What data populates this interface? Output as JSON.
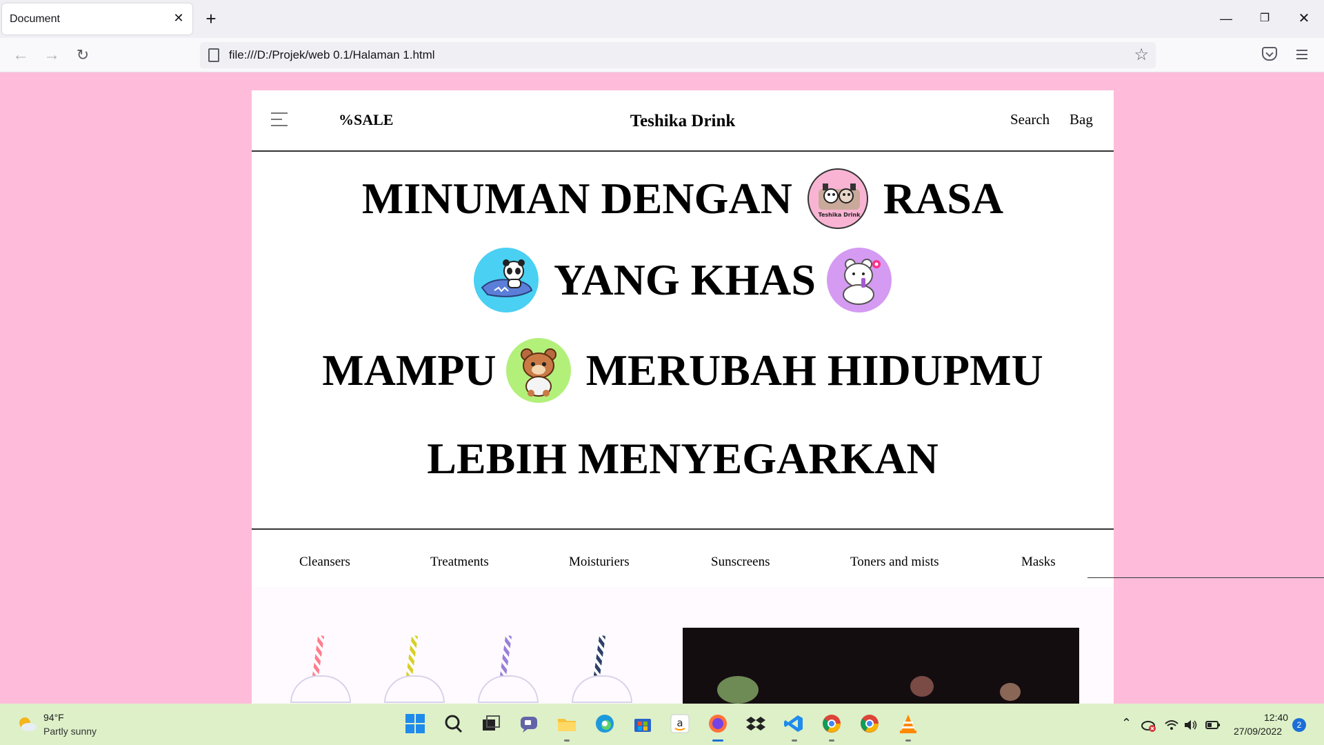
{
  "browser": {
    "tab_title": "Document",
    "tab_close": "✕",
    "new_tab": "+",
    "url": "file:///D:/Projek/web 0.1/Halaman 1.html",
    "window_controls": {
      "minimize": "—",
      "restore": "❐",
      "close": "✕"
    },
    "nav": {
      "back": "←",
      "forward": "→",
      "reload": "↻",
      "star": "☆"
    }
  },
  "site": {
    "sale_label": "%SALE",
    "brand": "Teshika Drink",
    "search_label": "Search",
    "bag_label": "Bag",
    "hero": {
      "line1_a": "MINUMAN DENGAN",
      "line1_b": "RASA",
      "line2": "YANG KHAS",
      "line3_a": "MAMPU",
      "line3_b": "MERUBAH HIDUPMU",
      "line4": "LEBIH MENYEGARKAN"
    },
    "logo_caption": "Teshika Drink",
    "categories": [
      "Cleansers",
      "Treatments",
      "Moisturiers",
      "Sunscreens",
      "Toners and mists",
      "Masks"
    ],
    "mascot_colors": {
      "logo": "#f9b4d3",
      "shark_panda": "#4ad0f3",
      "bear_white": "#d59af2",
      "bear_brown": "#b2f07a"
    }
  },
  "taskbar": {
    "temperature": "94°F",
    "weather": "Partly sunny",
    "time": "12:40",
    "date": "27/09/2022",
    "notifications": "2"
  }
}
